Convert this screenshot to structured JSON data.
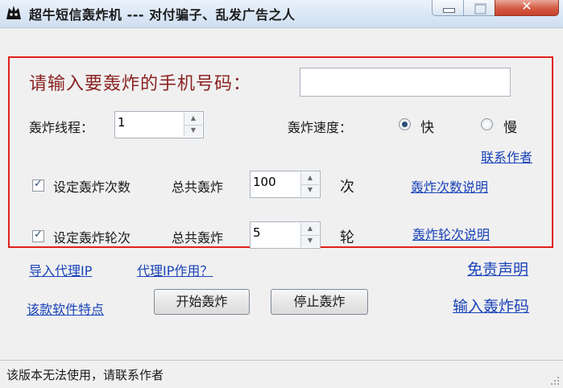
{
  "window": {
    "title": "超牛短信轰炸机 --- 对付骗子、乱发广告之人"
  },
  "phone": {
    "label": "请输入要轰炸的手机号码：",
    "value": ""
  },
  "threads": {
    "label": "轰炸线程：",
    "value": "1"
  },
  "speed": {
    "label": "轰炸速度：",
    "fast": "快",
    "slow": "慢",
    "selected": "快"
  },
  "contact_author": "联系作者",
  "count_setting": {
    "check_label": "设定轰炸次数",
    "total_label": "总共轰炸",
    "value": "100",
    "unit": "次",
    "help_link": "轰炸次数说明",
    "checked": true
  },
  "round_setting": {
    "check_label": "设定轰炸轮次",
    "total_label": "总共轰炸",
    "value": "5",
    "unit": "轮",
    "help_link": "轰炸轮次说明",
    "checked": true
  },
  "links": {
    "import_proxy": "导入代理IP",
    "proxy_purpose": "代理IP作用？",
    "disclaimer": "免责声明",
    "features": "该款软件特点",
    "enter_code": "输入轰炸码"
  },
  "buttons": {
    "start": "开始轰炸",
    "stop": "停止轰炸"
  },
  "status": {
    "text": "该版本无法使用，请联系作者"
  },
  "colors": {
    "highlight_border": "#e0201c",
    "link": "#1a43b8",
    "heading": "#8a2222"
  }
}
